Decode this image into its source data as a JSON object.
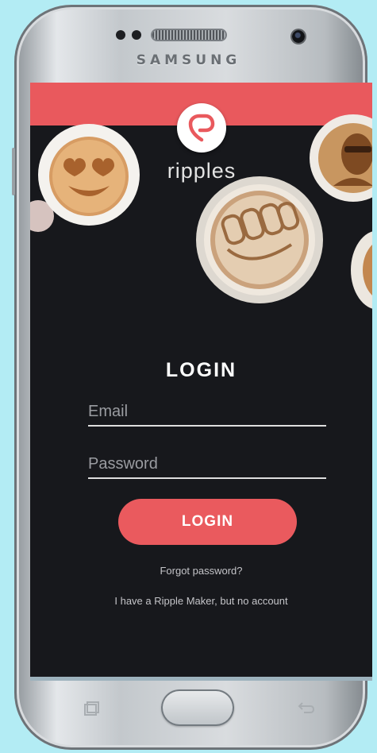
{
  "device": {
    "brand": "SAMSUNG"
  },
  "app": {
    "logo_text": "ripples",
    "brand_color": "#e9595d",
    "background_color": "#17181c"
  },
  "login": {
    "title": "LOGIN",
    "email_placeholder": "Email",
    "password_placeholder": "Password",
    "button_label": "LOGIN",
    "forgot_password": "Forgot password?",
    "no_account": "I have a Ripple Maker, but no account"
  },
  "icons": {
    "logo": "ripples-logo-icon",
    "recents": "recent-apps-icon",
    "back": "back-icon"
  }
}
